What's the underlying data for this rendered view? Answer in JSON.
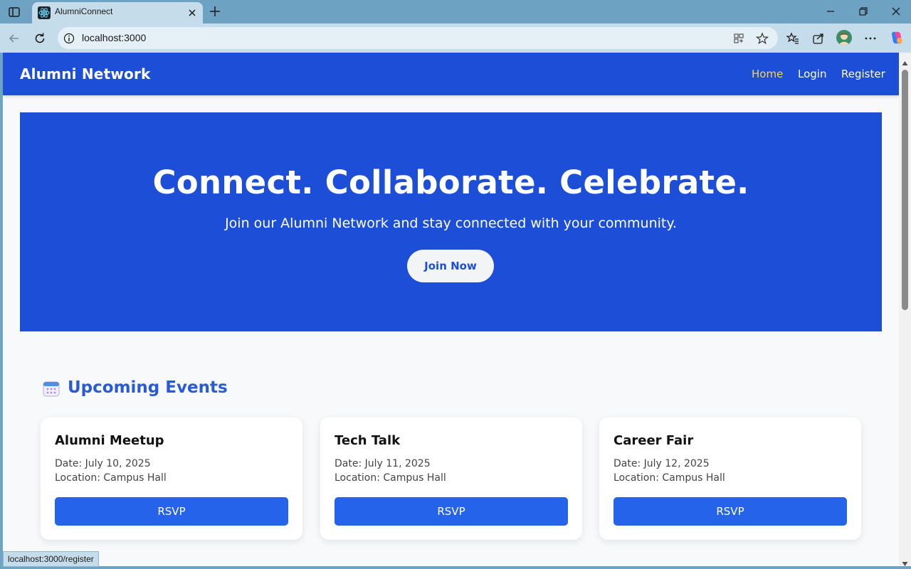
{
  "browser": {
    "tab": {
      "title": "AlumniConnect",
      "favicon": "react-atom-icon"
    },
    "address": {
      "url": "localhost:3000"
    },
    "status_url": "localhost:3000/register"
  },
  "navbar": {
    "brand": "Alumni Network",
    "links": [
      {
        "label": "Home",
        "active": true
      },
      {
        "label": "Login",
        "active": false
      },
      {
        "label": "Register",
        "active": false
      }
    ]
  },
  "hero": {
    "title": "Connect. Collaborate. Celebrate.",
    "subtitle": "Join our Alumni Network and stay connected with your community.",
    "cta": "Join Now"
  },
  "events": {
    "heading": "Upcoming Events",
    "icon": "calendar-icon",
    "items": [
      {
        "title": "Alumni Meetup",
        "date": "Date: July 10, 2025",
        "location": "Location: Campus Hall",
        "button": "RSVP"
      },
      {
        "title": "Tech Talk",
        "date": "Date: July 11, 2025",
        "location": "Location: Campus Hall",
        "button": "RSVP"
      },
      {
        "title": "Career Fair",
        "date": "Date: July 12, 2025",
        "location": "Location: Campus Hall",
        "button": "RSVP"
      }
    ]
  },
  "colors": {
    "primary": "#1d4ed8",
    "button": "#2563eb",
    "active_link": "#fcd34d",
    "page_bg": "#f8f9fb"
  }
}
